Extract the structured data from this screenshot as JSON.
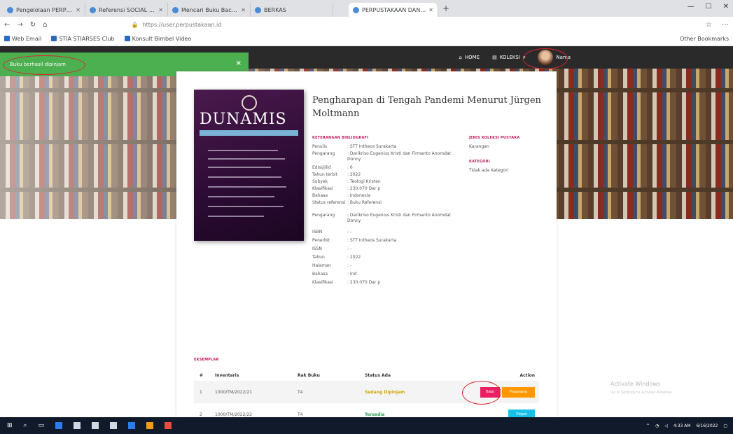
{
  "browser": {
    "tabs": [
      {
        "label": "Pengelolaan PERPUSTAKAAN",
        "active": false
      },
      {
        "label": "Referensi SOCIAL LIBRARY",
        "active": false
      },
      {
        "label": "Mencari Buku Bacaan",
        "active": false
      },
      {
        "label": "BERKAS",
        "active": false
      },
      {
        "label": "PERPUSTAKAAN DAN PEMBACA",
        "active": true
      }
    ],
    "new_tab": "+",
    "url": "https://user.perpustakaan.id",
    "bookmarks": [
      "Web Email",
      "STIA STIARSES Club",
      "Konsult Bimbel Video"
    ],
    "other_bookmarks": "Other Bookmarks"
  },
  "site": {
    "toast": {
      "message": "Buku berhasil dipinjam",
      "close": "×"
    },
    "nav": {
      "home": "HOME",
      "koleksi": "KOLEKSI",
      "user": "Nama"
    },
    "book": {
      "cover_title": "DUNAMIS",
      "title": "Pengharapan di Tengah Pandemi Menurut Jürgen Moltmann",
      "info_heading": "KETERANGAN BIBLIOGRAFI",
      "meta": [
        {
          "k": "Penulis",
          "v": ": STT Intheos Surakarta"
        },
        {
          "k": "Pengarang",
          "v": ": Darikriso Eugenius Kristi dan Firmanto Anomdat Donny"
        },
        {
          "k": "Edisi/Jilid",
          "v": ": 6"
        },
        {
          "k": "Tahun terbit",
          "v": ": 2022"
        },
        {
          "k": "Subyek",
          "v": ": Teologi Kristen"
        },
        {
          "k": "Klasifikasi",
          "v": ": 230.070 Dar p"
        },
        {
          "k": "Bahasa",
          "v": ": Indonesia"
        },
        {
          "k": "Status referensi",
          "v": ": Buku Referensi"
        },
        {
          "k": "Pengarang",
          "v": ": Darikriso Eugenius Kristi dan Firmanto Anomdat Donny"
        },
        {
          "k": "ISBN",
          "v": ": -"
        },
        {
          "k": "Penerbit",
          "v": ": STT Intheos Surakarta"
        },
        {
          "k": "ISSN",
          "v": ": -"
        },
        {
          "k": "Tahun",
          "v": ": 2022"
        },
        {
          "k": "Halaman",
          "v": ": -"
        },
        {
          "k": "Bahasa",
          "v": ": Ind"
        },
        {
          "k": "Klasifikasi",
          "v": ": 230.070 Dar p"
        }
      ],
      "side_heading1": "JENIS KOLEKSI PUSTAKA",
      "side_value1": "Karangan",
      "side_heading2": "KATEGORI",
      "side_value2": "Tidak ada Kategori"
    },
    "copies": {
      "heading": "EKSEMPLAR",
      "columns": [
        "#",
        "Inventaris",
        "Rak Buku",
        "Status Ada",
        "Action"
      ],
      "rows": [
        {
          "no": "1",
          "inv": "1000/TM/2022/21",
          "loc": "T4",
          "status": "Sedang Dipinjam",
          "status_type": "warn",
          "buttons": [
            "Batal",
            "Perpanjang"
          ]
        },
        {
          "no": "2",
          "inv": "1000/TM/2022/22",
          "loc": "T4",
          "status": "Tersedia",
          "status_type": "ok",
          "buttons": [
            "Pinjam"
          ]
        }
      ]
    },
    "watermark": {
      "line1": "Activate Windows",
      "line2": "Go to Settings to activate Windows."
    }
  },
  "taskbar": {
    "time": "4:33 AM",
    "date": "6/16/2022"
  },
  "colors": {
    "toast": "#4caf50",
    "nav": "#2a2a2a",
    "accent_pink": "#e91e63",
    "accent_orange": "#ff9800",
    "accent_cyan": "#17c1e8",
    "annotation_red": "#d9242c"
  }
}
